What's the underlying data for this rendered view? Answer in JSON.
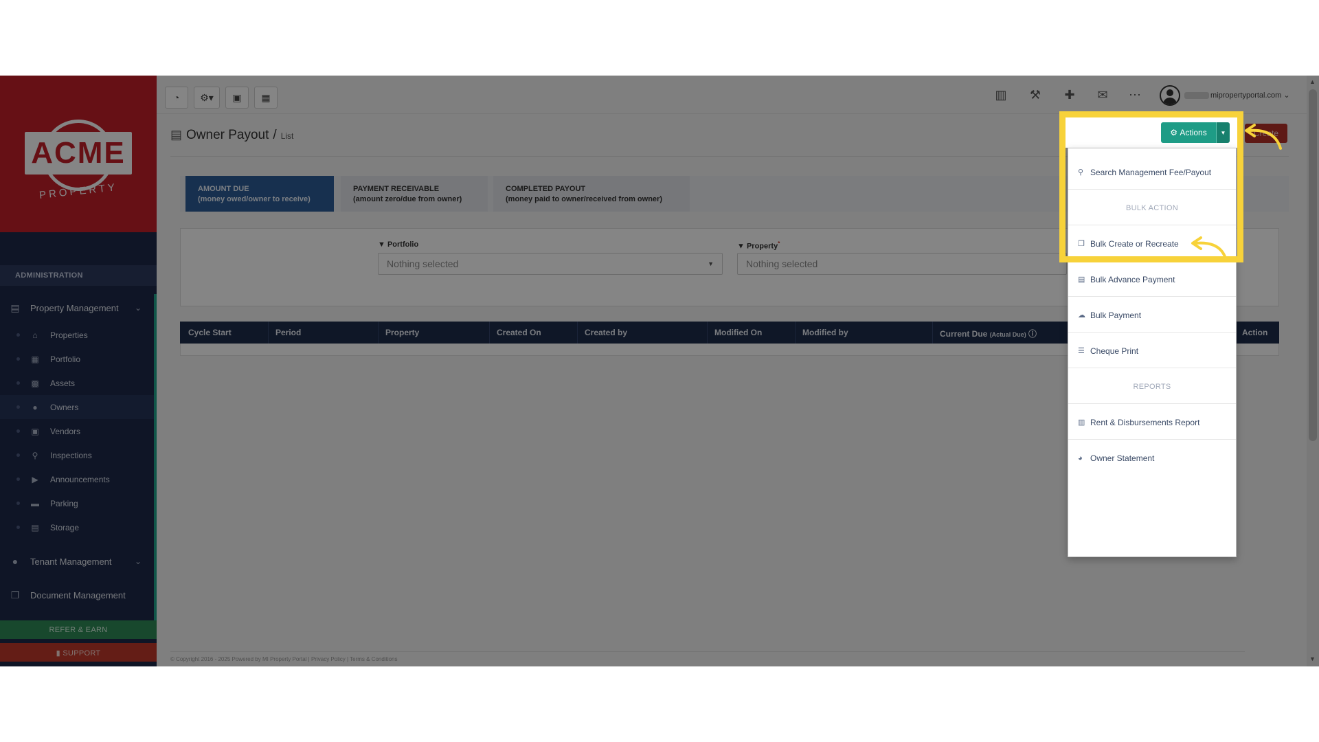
{
  "sidebar": {
    "logo_text": "ACME",
    "logo_sub": "PROPERTY",
    "admin_header": "ADMINISTRATION",
    "property_management": "Property Management",
    "sub_items": [
      {
        "label": "Properties",
        "icon": "home-icon"
      },
      {
        "label": "Portfolio",
        "icon": "portfolio-icon"
      },
      {
        "label": "Assets",
        "icon": "assets-icon"
      },
      {
        "label": "Owners",
        "icon": "user-icon"
      },
      {
        "label": "Vendors",
        "icon": "briefcase-icon"
      },
      {
        "label": "Inspections",
        "icon": "magnify-icon"
      },
      {
        "label": "Announcements",
        "icon": "megaphone-icon"
      },
      {
        "label": "Parking",
        "icon": "car-icon"
      },
      {
        "label": "Storage",
        "icon": "storage-icon"
      }
    ],
    "tenant_management": "Tenant Management",
    "document_management": "Document Management",
    "refer_earn": "REFER & EARN",
    "support": "SUPPORT"
  },
  "topbar": {
    "user_email": "mipropertyportal.com"
  },
  "page": {
    "title": "Owner Payout",
    "separator": "/",
    "subtitle": "List",
    "create_label": "Create"
  },
  "tabs": [
    {
      "line1": "AMOUNT DUE",
      "line2": "(money owed/owner to receive)",
      "active": true
    },
    {
      "line1": "PAYMENT RECEIVABLE",
      "line2": "(amount zero/due from owner)",
      "active": false
    },
    {
      "line1": "COMPLETED PAYOUT",
      "line2": "(money paid to owner/received from owner)",
      "active": false
    }
  ],
  "filters": {
    "portfolio_label": "Portfolio",
    "portfolio_value": "Nothing selected",
    "property_label": "Property",
    "property_required": "*",
    "property_value": "Nothing selected"
  },
  "table": {
    "columns": [
      "Cycle Start",
      "Period",
      "Property",
      "Created On",
      "Created by",
      "Modified On",
      "Modified by",
      "Current Due",
      "Action"
    ],
    "current_due_note": "(Actual Due)"
  },
  "actions_menu": {
    "button_label": "Actions",
    "search": "Search Management Fee/Payout",
    "bulk_header": "BULK ACTION",
    "bulk_create": "Bulk Create or Recreate",
    "bulk_advance": "Bulk Advance Payment",
    "bulk_payment": "Bulk Payment",
    "cheque_print": "Cheque Print",
    "reports_header": "REPORTS",
    "rent_report": "Rent & Disbursements Report",
    "owner_statement": "Owner Statement"
  },
  "footer": {
    "text": "© Copyright 2016 - 2025 Powered by MI Property Portal | Privacy Policy | Terms & Conditions"
  },
  "colors": {
    "highlight": "#f7d23a",
    "actions_green": "#1e9c86",
    "brand_red": "#c4202a",
    "sidebar_navy": "#1e2a4a"
  }
}
